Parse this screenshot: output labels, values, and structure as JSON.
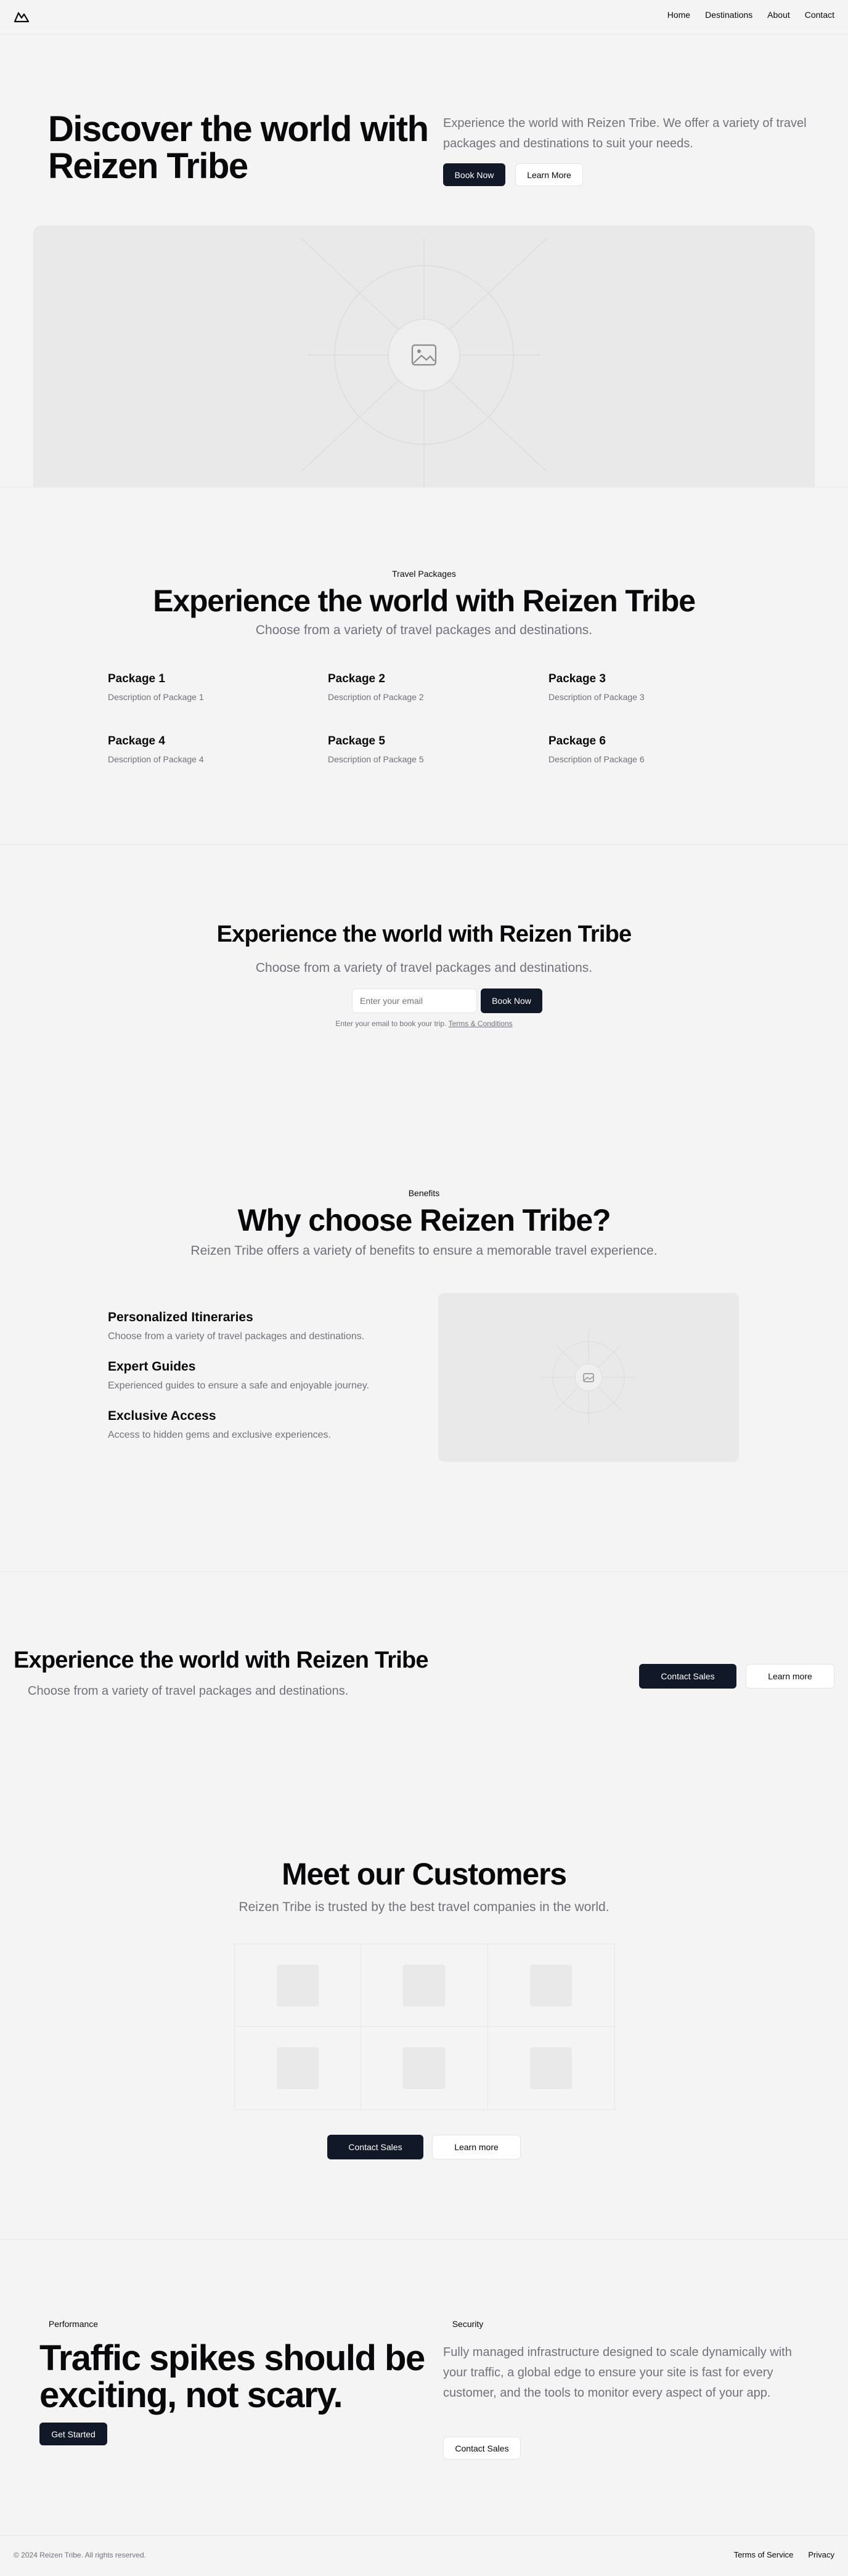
{
  "nav": {
    "logo_icon": "mountain-icon",
    "links": [
      "Home",
      "Destinations",
      "About",
      "Contact"
    ]
  },
  "hero": {
    "title_line1": "Discover the world with",
    "title_line2": "Reizen Tribe",
    "description": "Experience the world with Reizen Tribe. We offer a variety of travel packages and destinations to suit your needs.",
    "primary_cta": "Book Now",
    "secondary_cta": "Learn More",
    "image_icon": "image-placeholder-icon"
  },
  "packages": {
    "badge": "Travel Packages",
    "title": "Experience the world with Reizen Tribe",
    "subtitle": "Choose from a variety of travel packages and destinations.",
    "items": [
      {
        "title": "Package 1",
        "desc": "Description of Package 1"
      },
      {
        "title": "Package 2",
        "desc": "Description of Package 2"
      },
      {
        "title": "Package 3",
        "desc": "Description of Package 3"
      },
      {
        "title": "Package 4",
        "desc": "Description of Package 4"
      },
      {
        "title": "Package 5",
        "desc": "Description of Package 5"
      },
      {
        "title": "Package 6",
        "desc": "Description of Package 6"
      }
    ]
  },
  "signup": {
    "title": "Experience the world with Reizen Tribe",
    "subtitle": "Choose from a variety of travel packages and destinations.",
    "email_placeholder": "Enter your email",
    "button": "Book Now",
    "note_prefix": "Enter your email to book your trip.",
    "note_link": "Terms & Conditions"
  },
  "benefits": {
    "badge": "Benefits",
    "title": "Why choose Reizen Tribe?",
    "subtitle": "Reizen Tribe offers a variety of benefits to ensure a memorable travel experience.",
    "items": [
      {
        "title": "Personalized Itineraries",
        "desc": "Choose from a variety of travel packages and destinations."
      },
      {
        "title": "Expert Guides",
        "desc": "Experienced guides to ensure a safe and enjoyable journey."
      },
      {
        "title": "Exclusive Access",
        "desc": "Access to hidden gems and exclusive experiences."
      }
    ]
  },
  "cta_banner": {
    "title": "Experience the world with Reizen Tribe",
    "subtitle": "Choose from a variety of travel packages and destinations.",
    "primary": "Contact Sales",
    "secondary": "Learn more"
  },
  "customers": {
    "title": "Meet our Customers",
    "subtitle": "Reizen Tribe is trusted by the best travel companies in the world.",
    "primary": "Contact Sales",
    "secondary": "Learn more"
  },
  "features": {
    "left_badge": "Performance",
    "left_title_line1": "Traffic spikes should be",
    "left_title_line2": "exciting, not scary.",
    "left_cta": "Get Started",
    "right_badge": "Security",
    "right_text": "Fully managed infrastructure designed to scale dynamically with your traffic, a global edge to ensure your site is fast for every customer, and the tools to monitor every aspect of your app.",
    "right_cta": "Contact Sales"
  },
  "footer": {
    "copyright": "© 2024 Reizen Tribe. All rights reserved.",
    "links": [
      "Terms of Service",
      "Privacy"
    ]
  }
}
